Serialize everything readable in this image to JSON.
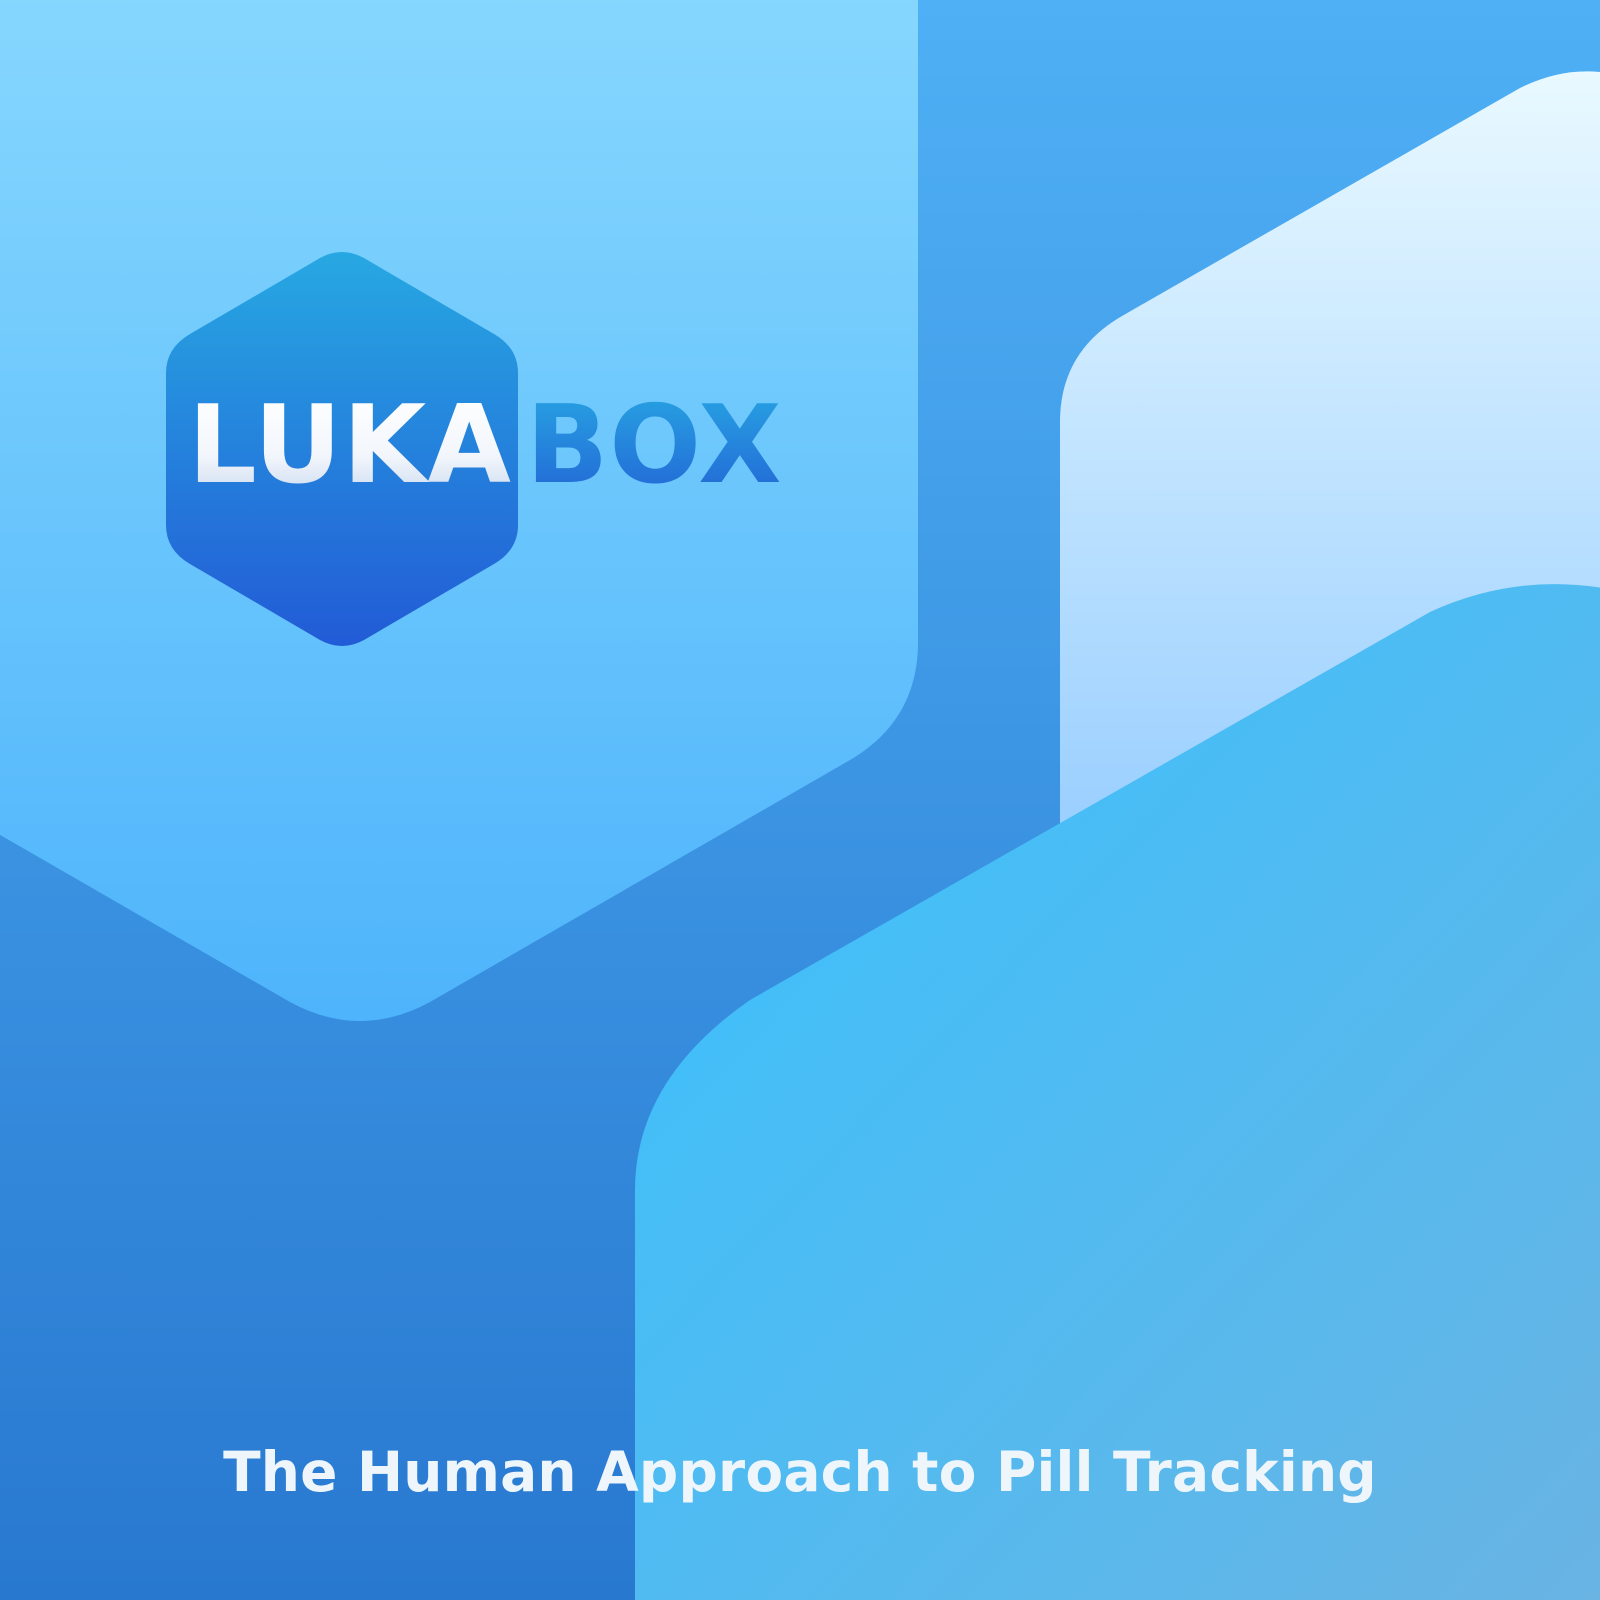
{
  "brand": {
    "name_part1": "LUKA",
    "name_part2": "BOX"
  },
  "tagline": "The Human Approach to Pill Tracking",
  "colors": {
    "background_top": "#4fb0f5",
    "background_bottom": "#2878d0",
    "hex_light_top": "#9ee6ff",
    "hex_light_bottom": "#4eb4fb",
    "hex_pale_top": "#e9f9ff",
    "hex_pale_bottom": "#7ec0ff",
    "hex_cyan": "#3ec1fb",
    "logo_hex_top": "#27a8e2",
    "logo_hex_bottom": "#225bd6"
  }
}
